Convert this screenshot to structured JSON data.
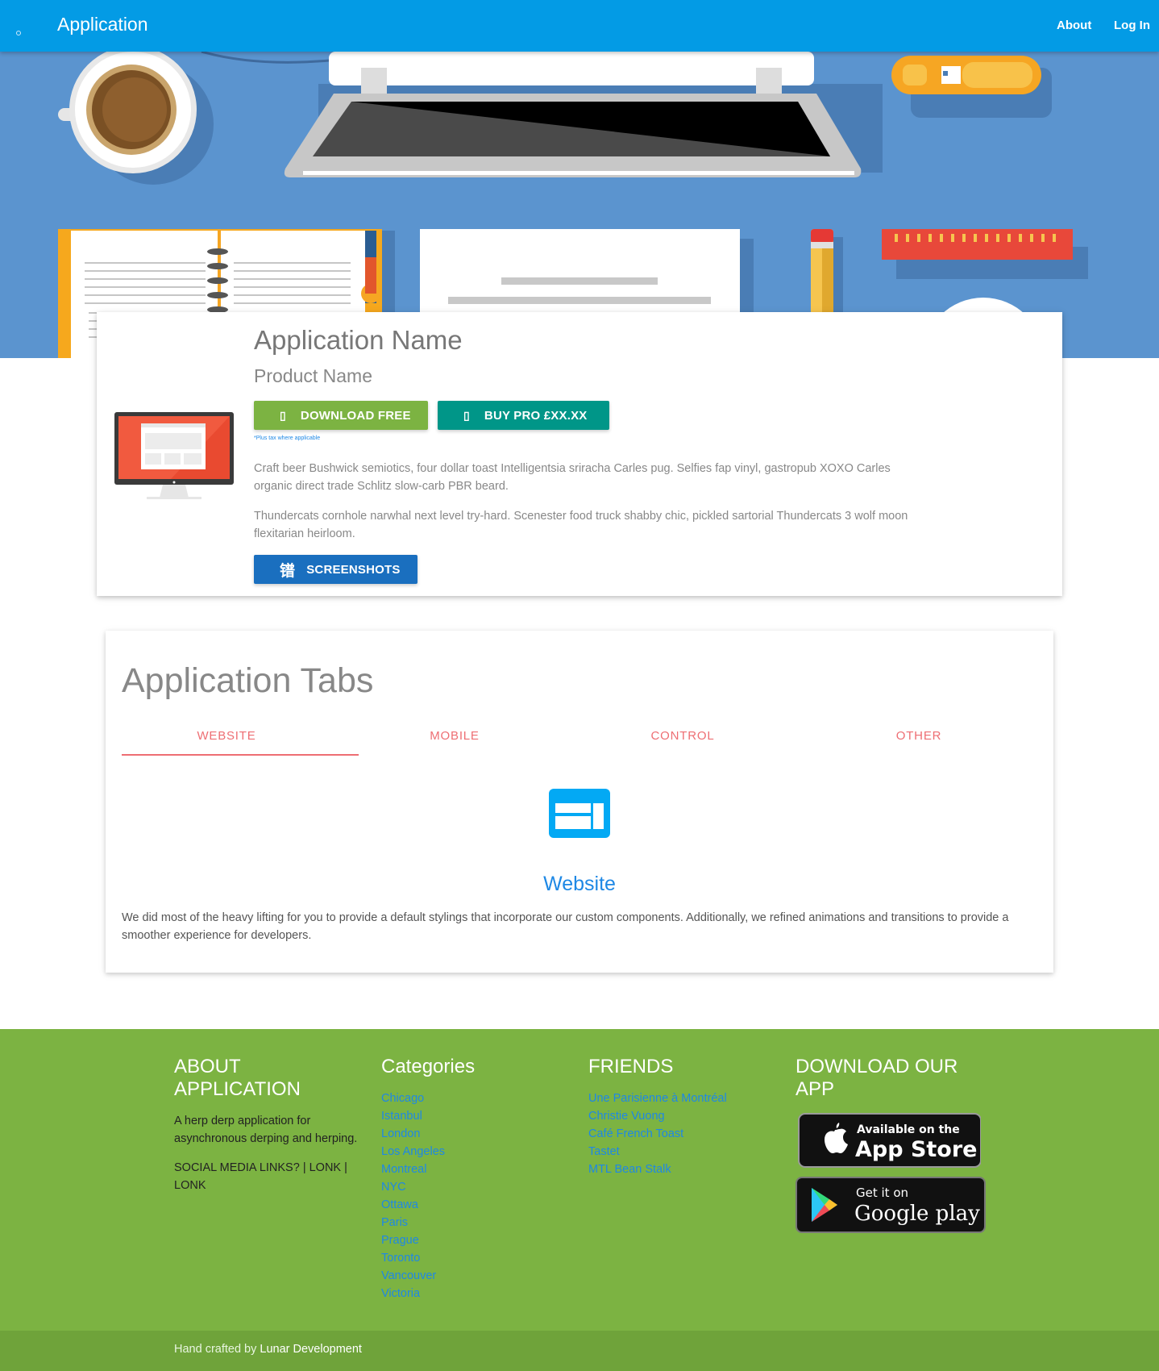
{
  "nav": {
    "brand": "Application",
    "links": [
      "About",
      "Log In"
    ]
  },
  "app": {
    "name": "Application Name",
    "product": "Product Name",
    "download_label": "DOWNLOAD FREE",
    "buy_label": "BUY PRO £XX.XX",
    "tax_note": "*Plus tax where applicable",
    "description": [
      "Craft beer Bushwick semiotics, four dollar toast Intelligentsia sriracha Carles pug. Selfies fap vinyl, gastropub XOXO Carles organic direct trade Schlitz slow-carb PBR beard.",
      "Thundercats cornhole narwhal next level try-hard. Scenester food truck shabby chic, pickled sartorial Thundercats 3 wolf moon flexitarian heirloom."
    ],
    "screenshots_label": "SCREENSHOTS",
    "screenshots_glyph": "镨"
  },
  "tabs": {
    "title": "Application Tabs",
    "items": [
      "WEBSITE",
      "MOBILE",
      "CONTROL",
      "OTHER"
    ],
    "active": "WEBSITE",
    "active_heading": "Website",
    "active_text": "We did most of the heavy lifting for you to provide a default stylings that incorporate our custom components. Additionally, we refined animations and transitions to provide a smoother experience for developers."
  },
  "footer": {
    "about": {
      "title": "ABOUT APPLICATION",
      "text": "A herp derp application for asynchronous derping and herping.",
      "social": "SOCIAL MEDIA LINKS? | LONK | LONK"
    },
    "categories": {
      "title": "Categories",
      "items": [
        "Chicago",
        "Istanbul",
        "London",
        "Los Angeles",
        "Montreal",
        "NYC",
        "Ottawa",
        "Paris",
        "Prague",
        "Toronto",
        "Vancouver",
        "Victoria"
      ]
    },
    "friends": {
      "title": "FRIENDS",
      "items": [
        "Une Parisienne à Montréal",
        "Christie Vuong",
        "Café French Toast",
        "Tastet",
        "MTL Bean Stalk"
      ]
    },
    "download": {
      "title": "DOWNLOAD OUR APP",
      "appstore_small": "Available on the",
      "appstore_big": "App Store",
      "play_small": "Get it on",
      "play_big": "Google play"
    },
    "credit_prefix": "Hand crafted by",
    "credit_name": "Lunar Development"
  },
  "colors": {
    "nav": "#039be5",
    "hero": "#5b94cf",
    "green": "#7cb342",
    "teal": "#009688",
    "blue": "#1a6fbf",
    "tab_accent": "#ee6e73",
    "link": "#1e88e5"
  }
}
